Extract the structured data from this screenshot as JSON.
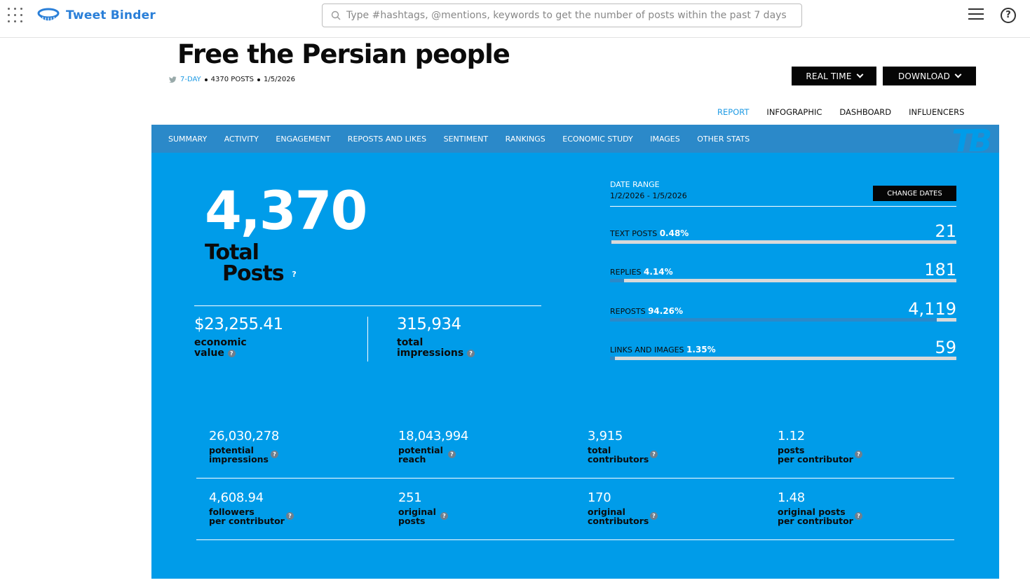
{
  "topbar": {
    "brand": "Tweet Binder",
    "search_placeholder": "Type #hashtags, @mentions, keywords to get the number of posts within the past 7 days"
  },
  "header": {
    "title": "Free the Persian people",
    "period": "7-DAY",
    "posts_count": "4370 POSTS",
    "date": "1/5/2026",
    "realtime_label": "REAL TIME",
    "download_label": "DOWNLOAD"
  },
  "view_tabs": [
    "REPORT",
    "INFOGRAPHIC",
    "DASHBOARD",
    "INFLUENCERS"
  ],
  "subnav": [
    "SUMMARY",
    "ACTIVITY",
    "ENGAGEMENT",
    "REPOSTS AND LIKES",
    "SENTIMENT",
    "RANKINGS",
    "ECONOMIC STUDY",
    "IMAGES",
    "OTHER STATS"
  ],
  "summary": {
    "total_posts": "4,370",
    "total_label_1": "Total",
    "total_label_2": "Posts",
    "economic_value": "$23,255.41",
    "economic_label_1": "economic",
    "economic_label_2": "value",
    "total_impressions": "315,934",
    "impressions_label_1": "total",
    "impressions_label_2": "impressions"
  },
  "date_range": {
    "label": "DATE RANGE",
    "value": "1/2/2026 - 1/5/2026",
    "change_label": "CHANGE DATES"
  },
  "breakdown": [
    {
      "label": "TEXT POSTS",
      "pct": "0.48%",
      "fraction": 0.0048,
      "value": "21"
    },
    {
      "label": "REPLIES",
      "pct": "4.14%",
      "fraction": 0.0414,
      "value": "181"
    },
    {
      "label": "REPOSTS",
      "pct": "94.26%",
      "fraction": 0.9426,
      "value": "4,119"
    },
    {
      "label": "LINKS AND IMAGES",
      "pct": "1.35%",
      "fraction": 0.0135,
      "value": "59"
    }
  ],
  "metrics": [
    {
      "value": "26,030,278",
      "l1": "potential",
      "l2": "impressions"
    },
    {
      "value": "18,043,994",
      "l1": "potential",
      "l2": "reach"
    },
    {
      "value": "3,915",
      "l1": "total",
      "l2": "contributors"
    },
    {
      "value": "1.12",
      "l1": "posts",
      "l2": "per contributor"
    },
    {
      "value": "4,608.94",
      "l1": "followers",
      "l2": "per contributor"
    },
    {
      "value": "251",
      "l1": "original",
      "l2": "posts"
    },
    {
      "value": "170",
      "l1": "original",
      "l2": "contributors"
    },
    {
      "value": "1.48",
      "l1": "original posts",
      "l2": "per contributor"
    }
  ],
  "colors": {
    "accent": "#009ce9",
    "subnav": "#2b89c9",
    "brand": "#2a7fd8"
  }
}
